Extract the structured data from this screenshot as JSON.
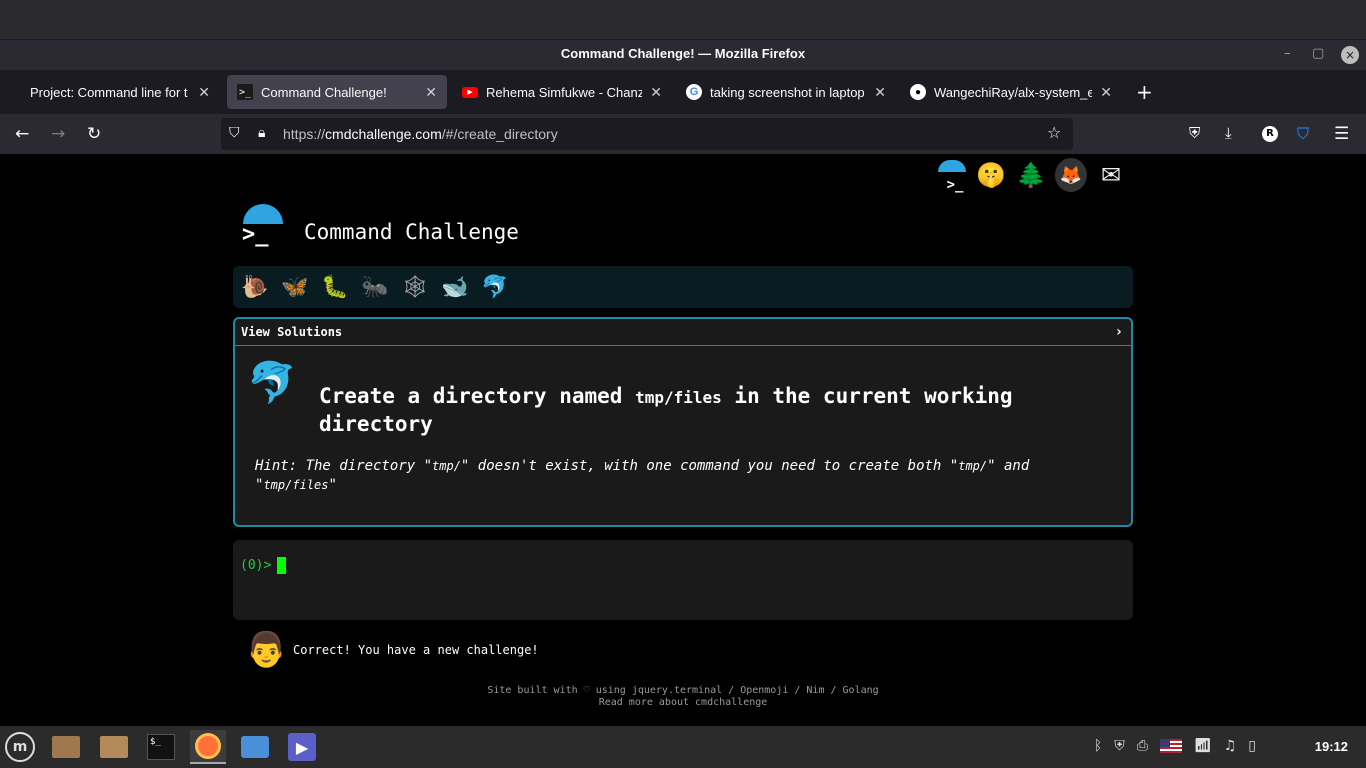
{
  "window": {
    "title": "Command Challenge! — Mozilla Firefox",
    "minimize_icon": "minimize-icon",
    "maximize_icon": "maximize-icon",
    "close_icon": "close-icon"
  },
  "tabs": [
    {
      "label": "Project: Command line for t",
      "favicon": "",
      "active": false
    },
    {
      "label": "Command Challenge!",
      "favicon": ">_",
      "active": true
    },
    {
      "label": "Rehema Simfukwe - Chanzo",
      "favicon": "youtube",
      "active": false
    },
    {
      "label": "taking screenshot in laptop",
      "favicon": "google",
      "active": false
    },
    {
      "label": "WangechiRay/alx-system_e",
      "favicon": "github",
      "active": false
    }
  ],
  "nav": {
    "url_prefix": "https://",
    "url_host": "cmdchallenge.com",
    "url_path": "/#/create_directory",
    "profile_initial": "R"
  },
  "page": {
    "site_title": "Command Challenge",
    "top_icons": [
      "🤫",
      "🌲",
      "🦊",
      "✉"
    ],
    "progress_icons": [
      "🐌",
      "🦋",
      "🐛",
      "🐜",
      "🕸",
      "🐋",
      "🐬"
    ],
    "view_solutions": "View Solutions",
    "challenge_prefix": "Create a directory named ",
    "challenge_code": "tmp/files",
    "challenge_suffix": " in the current working directory",
    "hint_1": "Hint: The directory \"",
    "hint_code_1": "tmp/",
    "hint_2": "\" doesn't exist, with one command you need to create both \"",
    "hint_code_2": "tmp/",
    "hint_3": "\" and \"",
    "hint_code_3": "tmp/files",
    "hint_4": "\"",
    "prompt": "(0)>",
    "feedback": "Correct! You have a new challenge!",
    "footer_line1": "Site built with ♡ using jquery.terminal / Openmoji / Nim / Golang",
    "footer_line2": "Read more about cmdchallenge"
  },
  "taskbar": {
    "clock": "19:12",
    "apps": [
      "mint-menu-icon",
      "files-icon",
      "folder-icon",
      "terminal-icon",
      "firefox-icon",
      "screenshot-icon",
      "media-player-icon"
    ]
  }
}
